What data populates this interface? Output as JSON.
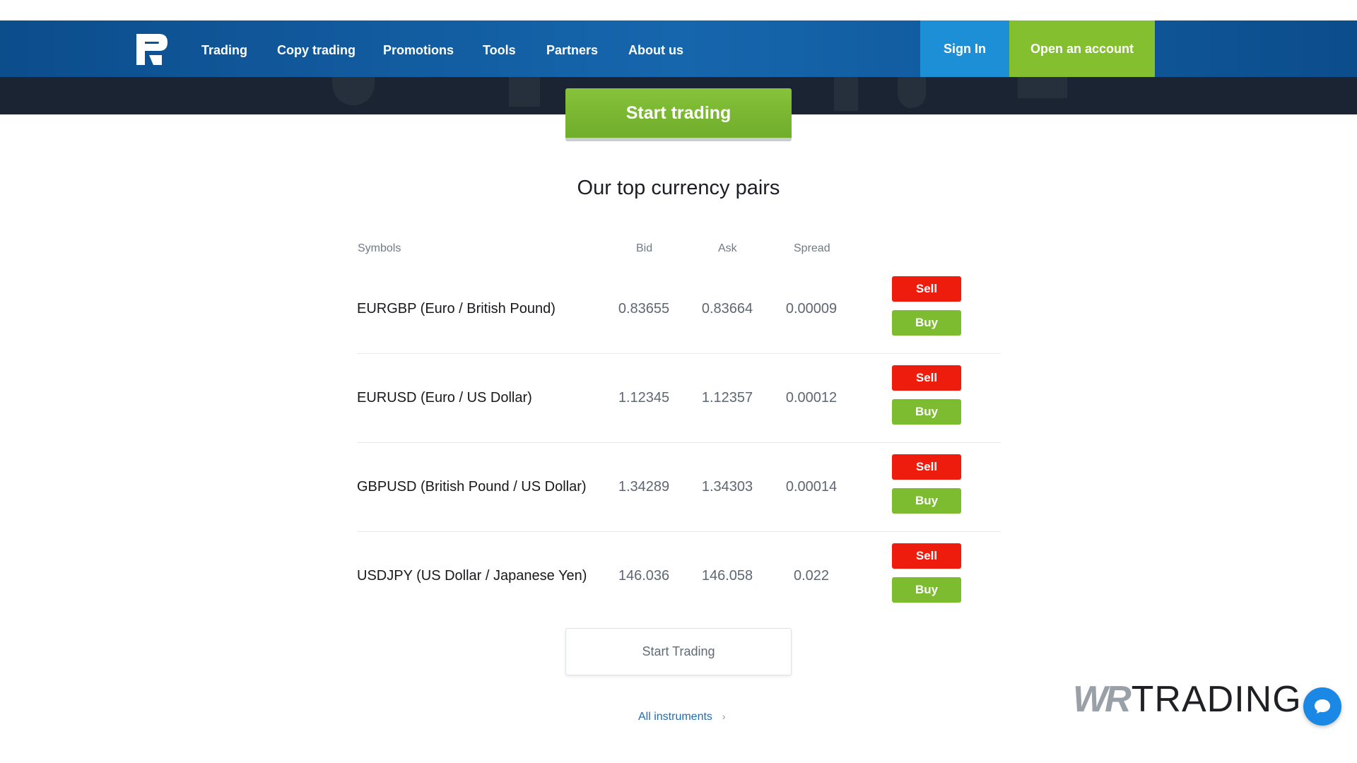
{
  "nav": {
    "items": [
      {
        "label": "Trading"
      },
      {
        "label": "Copy trading"
      },
      {
        "label": "Promotions"
      },
      {
        "label": "Tools"
      },
      {
        "label": "Partners"
      },
      {
        "label": "About us"
      }
    ],
    "sign_in": "Sign In",
    "open_account": "Open an account"
  },
  "hero": {
    "cta": "Start trading"
  },
  "pairs_section": {
    "title": "Our top currency pairs",
    "headers": {
      "symbols": "Symbols",
      "bid": "Bid",
      "ask": "Ask",
      "spread": "Spread"
    },
    "rows": [
      {
        "symbol": "EURGBP (Euro / British Pound)",
        "bid": "0.83655",
        "ask": "0.83664",
        "spread": "0.00009",
        "sell": "Sell",
        "buy": "Buy"
      },
      {
        "symbol": "EURUSD (Euro / US Dollar)",
        "bid": "1.12345",
        "ask": "1.12357",
        "spread": "0.00012",
        "sell": "Sell",
        "buy": "Buy"
      },
      {
        "symbol": "GBPUSD (British Pound / US Dollar)",
        "bid": "1.34289",
        "ask": "1.34303",
        "spread": "0.00014",
        "sell": "Sell",
        "buy": "Buy"
      },
      {
        "symbol": "USDJPY (US Dollar / Japanese Yen)",
        "bid": "146.036",
        "ask": "146.058",
        "spread": "0.022",
        "sell": "Sell",
        "buy": "Buy"
      }
    ],
    "start_trading": "Start Trading",
    "all_instruments": "All instruments"
  },
  "watermark": {
    "prefix": "WR",
    "text": "TRADING"
  },
  "colors": {
    "nav_bg": "#1666ad",
    "sign_in_bg": "#1d8fd6",
    "open_account_bg": "#83bf2f",
    "sell": "#ee1c0d",
    "buy": "#7dbb30",
    "link": "#1e6cb3"
  },
  "icons": {
    "logo": "r-logo",
    "chat": "chat-bubble-icon",
    "chevron": "chevron-right-icon"
  }
}
